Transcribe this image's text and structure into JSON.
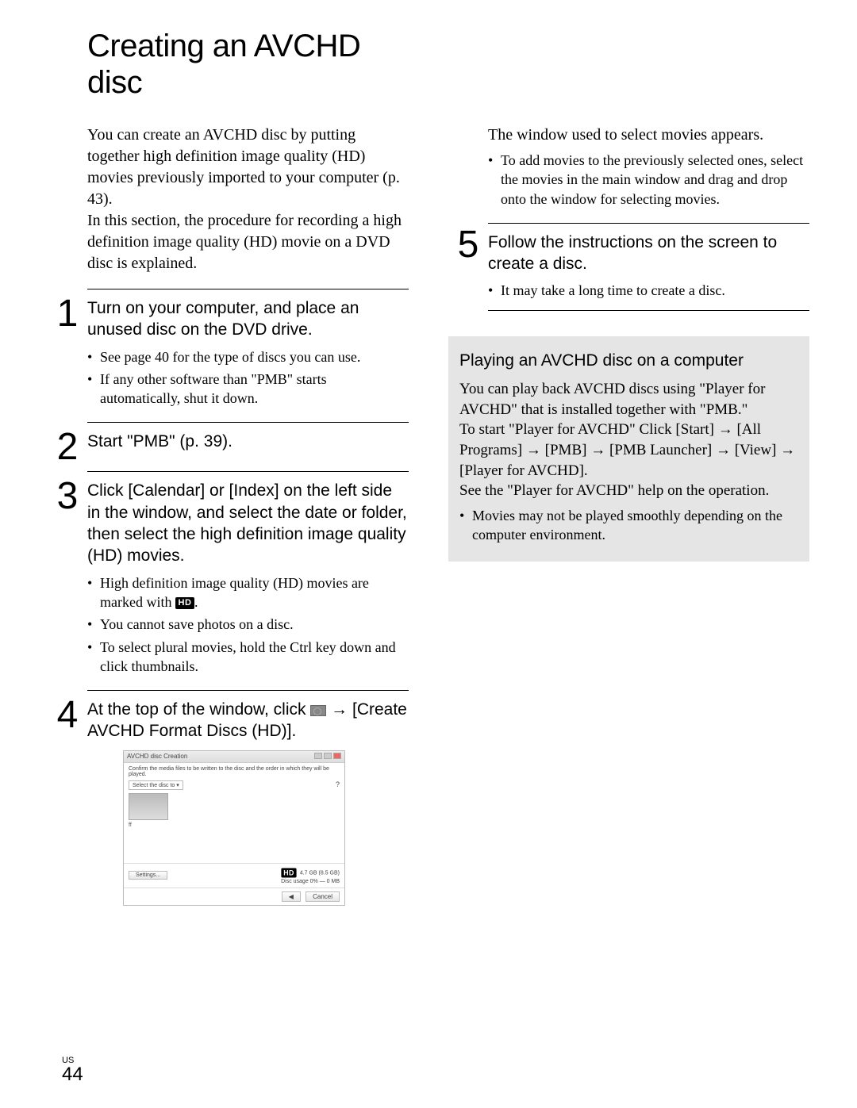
{
  "title": "Creating an AVCHD disc",
  "intro1": "You can create an AVCHD disc by putting together high definition image quality (HD) movies previously imported to your computer (p. 43).",
  "intro2": "In this section, the procedure for recording a high definition image quality (HD) movie on a DVD disc is explained.",
  "step1": {
    "num": "1",
    "title": "Turn on your computer, and place an unused disc on the DVD drive.",
    "b1": "See page 40 for the type of discs you can use.",
    "b2": "If any other software than \"PMB\" starts automatically, shut it down."
  },
  "step2": {
    "num": "2",
    "title": "Start \"PMB\" (p. 39)."
  },
  "step3": {
    "num": "3",
    "title": "Click [Calendar] or [Index] on the left side in the window, and select the date or folder, then select the high definition image quality (HD) movies.",
    "b1a": "High definition image quality (HD) movies are marked with ",
    "b1badge": "HD",
    "b1b": ".",
    "b2": "You cannot save photos on a disc.",
    "b3": "To select plural movies, hold the Ctrl key down and click thumbnails."
  },
  "step4": {
    "num": "4",
    "t1": "At the top of the window, click ",
    "t2": " → [Create AVCHD Format Discs (HD)]."
  },
  "right_text1": "The window used to select movies appears.",
  "right_b1": "To add movies to the previously selected ones, select the movies in the main window and drag and drop onto the window for selecting movies.",
  "step5": {
    "num": "5",
    "title": "Follow the instructions on the screen to create a disc.",
    "b1": "It may take a long time to create a disc."
  },
  "box": {
    "title": "Playing an AVCHD disc on a computer",
    "p1": "You can play back AVCHD discs using \"Player for AVCHD\" that is installed together with \"PMB.\"",
    "p2a": "To start \"Player for AVCHD\" Click [Start] ",
    "ar": "→",
    "p2b": " [All Programs] ",
    "p2c": " [PMB] ",
    "p2d": " [PMB Launcher] ",
    "p2e": " [View] ",
    "p2f": " [Player for AVCHD].",
    "p3": "See the \"Player for AVCHD\" help on the operation.",
    "b1": "Movies may not be played smoothly depending on the computer environment."
  },
  "screenshot": {
    "wintitle": "AVCHD disc Creation",
    "desc": "Confirm the media files to be written to the disc and the order in which they will be played.",
    "dropdown": "Select the disc to ▾",
    "thumb_label": "ff",
    "settings": "Settings...",
    "hd_small": "HD",
    "size_info": "4.7 GB (8.5 GB)",
    "usage": "Disc usage 0% — 0 MB",
    "btn_prev": "◀",
    "btn_cancel": "Cancel"
  },
  "footer": {
    "us": "US",
    "page": "44"
  }
}
